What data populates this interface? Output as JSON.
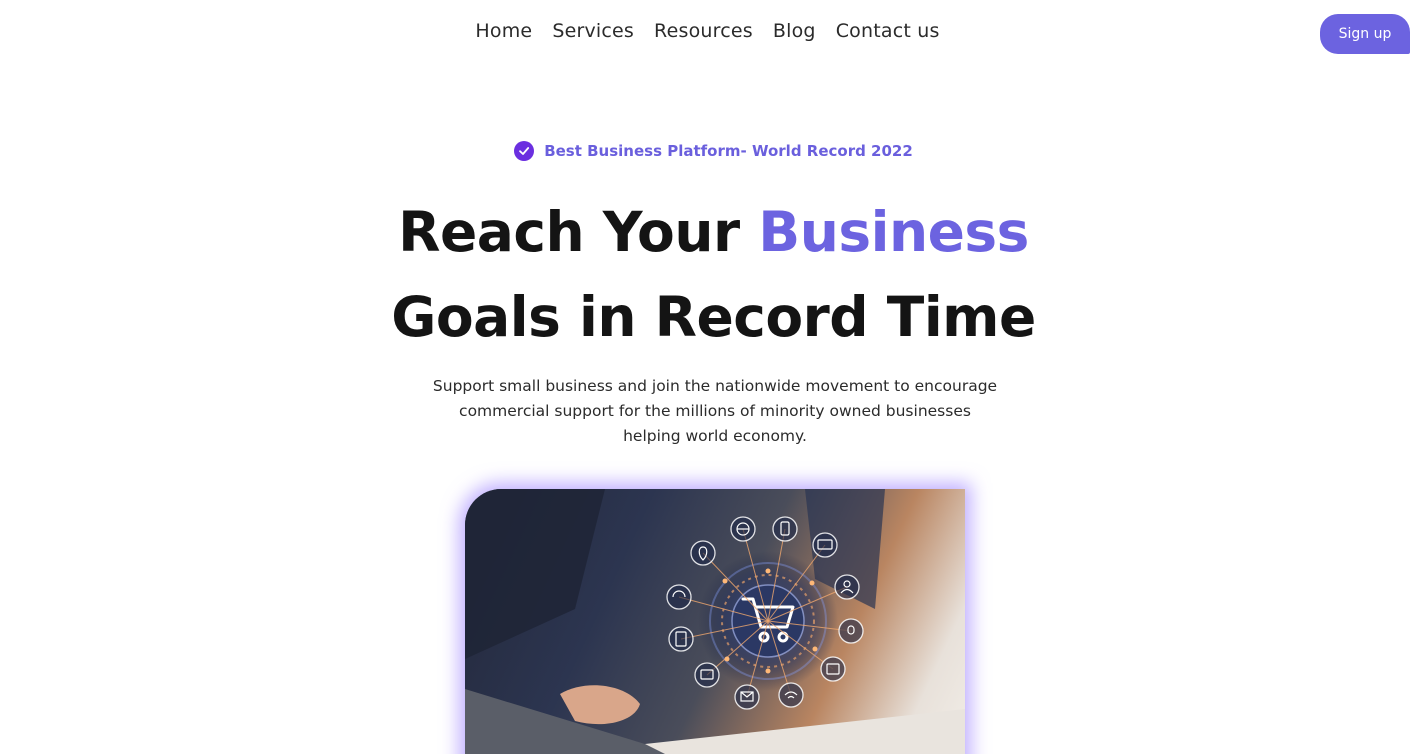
{
  "nav": {
    "items": [
      "Home",
      "Services",
      "Resources",
      "Blog",
      "Contact us"
    ],
    "signup_label": "Sign up"
  },
  "badge": {
    "text": "Best Business Platform- World Record 2022",
    "icon": "check-circle-icon"
  },
  "hero": {
    "headline_part1": "Reach Your ",
    "headline_accent": "Business",
    "headline_line2": "Goals in Record Time",
    "subtext": "Support small business and join the nationwide movement to encourage commercial support for the millions of minority owned businesses helping world economy."
  },
  "colors": {
    "accent": "#6c63e0",
    "badge_icon": "#6b2fe0",
    "heading": "#141414"
  }
}
